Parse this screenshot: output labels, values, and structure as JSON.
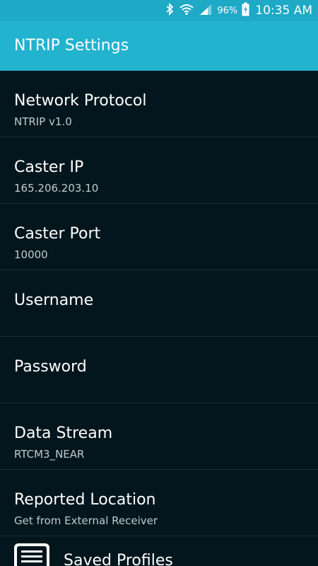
{
  "status_bar": {
    "battery_percent": "96%",
    "time": "10:35 AM",
    "icons": [
      "bluetooth-icon",
      "wifi-icon",
      "signal-icon",
      "battery-charging-icon"
    ]
  },
  "app_bar": {
    "title": "NTRIP Settings"
  },
  "settings": [
    {
      "title": "Network Protocol",
      "summary": "NTRIP v1.0"
    },
    {
      "title": "Caster IP",
      "summary": "165.206.203.10"
    },
    {
      "title": "Caster Port",
      "summary": "10000"
    },
    {
      "title": "Username",
      "summary": ""
    },
    {
      "title": "Password",
      "summary": ""
    },
    {
      "title": "Data Stream",
      "summary": "RTCM3_NEAR"
    },
    {
      "title": "Reported Location",
      "summary": "Get from External Receiver"
    }
  ],
  "saved_profiles": {
    "label": "Saved Profiles",
    "icon": "document-list-icon"
  },
  "colors": {
    "status_bar": "#1ea9c6",
    "app_bar": "#22b3cf",
    "background": "#03161d",
    "divider": "#1c2f36"
  }
}
